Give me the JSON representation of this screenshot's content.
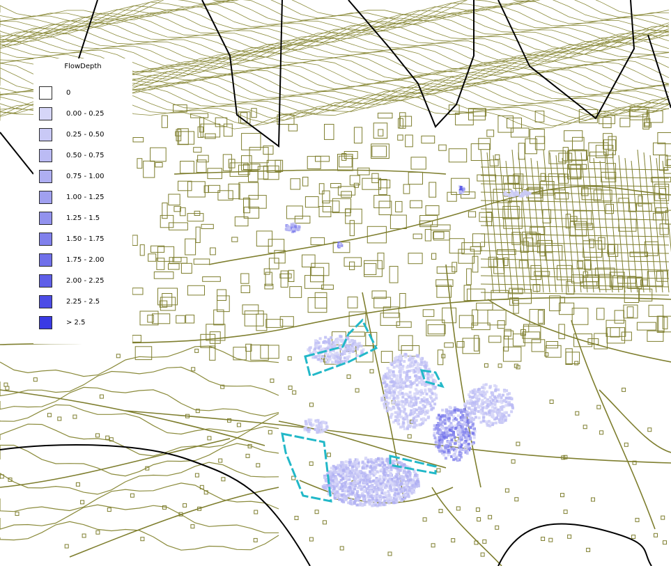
{
  "legend": {
    "title": "FlowDepth",
    "items": [
      {
        "label": "0",
        "color": "#ffffff"
      },
      {
        "label": "0.00 - 0.25",
        "color": "#d6d6f8"
      },
      {
        "label": "0.25 - 0.50",
        "color": "#c9c9f6"
      },
      {
        "label": "0.50 - 0.75",
        "color": "#bbbbf4"
      },
      {
        "label": "0.75 - 1.00",
        "color": "#aeaef2"
      },
      {
        "label": "1.00 - 1.25",
        "color": "#a0a0f0"
      },
      {
        "label": "1.25 - 1.5",
        "color": "#9292ee"
      },
      {
        "label": "1.50 - 1.75",
        "color": "#8080ec"
      },
      {
        "label": "1.75 - 2.00",
        "color": "#7070ea"
      },
      {
        "label": "2.00 - 2.25",
        "color": "#5e5ee8"
      },
      {
        "label": "2.25 - 2.5",
        "color": "#4c4ce6"
      },
      {
        "label": "> 2.5",
        "color": "#3a3ae4"
      }
    ]
  },
  "colors": {
    "contour": "#8a8a3a",
    "urban": "#7e7e2e",
    "boundary": "#000000",
    "zone_outline": "#22b8c8",
    "flood_light": "#c9c9f6",
    "flood_dark": "#5e5ee8"
  }
}
